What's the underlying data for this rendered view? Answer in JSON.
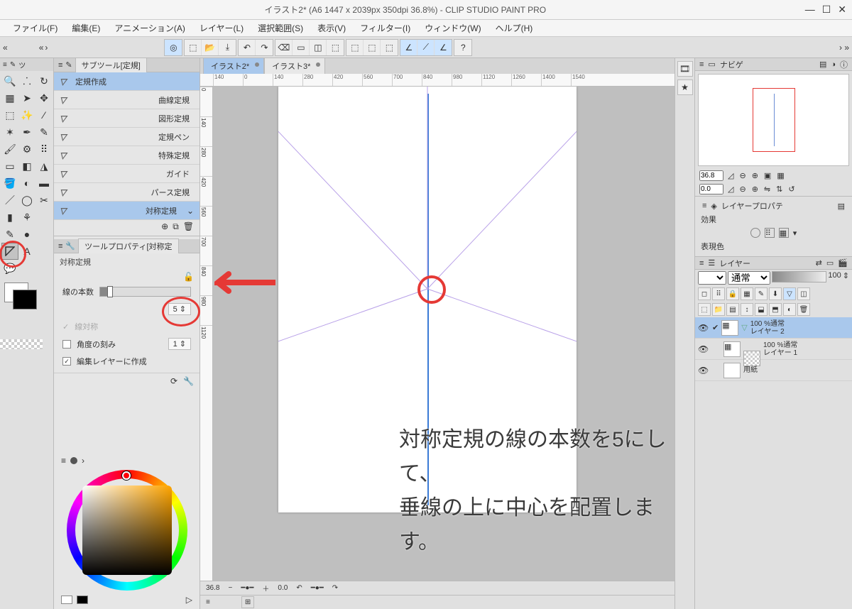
{
  "title": "イラスト2* (A6 1447 x 2039px 350dpi 36.8%)  -  CLIP STUDIO PAINT PRO",
  "menu": [
    "ファイル(F)",
    "編集(E)",
    "アニメーション(A)",
    "レイヤー(L)",
    "選択範囲(S)",
    "表示(V)",
    "フィルター(I)",
    "ウィンドウ(W)",
    "ヘルプ(H)"
  ],
  "docTabs": [
    {
      "label": "イラスト2*",
      "active": true
    },
    {
      "label": "イラスト3*",
      "active": false
    }
  ],
  "hRuler": [
    "140",
    "0",
    "140",
    "280",
    "420",
    "560",
    "700",
    "840",
    "980",
    "1120",
    "1260",
    "1400",
    "1540"
  ],
  "vRuler": [
    "0",
    "140",
    "280",
    "420",
    "560",
    "700",
    "840",
    "980",
    "1120"
  ],
  "subtool": {
    "title": "サブツール[定規]",
    "items": [
      {
        "label": "定規作成",
        "align": "left",
        "selected": true
      },
      {
        "label": "曲線定規",
        "selected": false
      },
      {
        "label": "図形定規",
        "selected": false
      },
      {
        "label": "定規ペン",
        "selected": false
      },
      {
        "label": "特殊定規",
        "selected": false
      },
      {
        "label": "ガイド",
        "selected": false
      },
      {
        "label": "パース定規",
        "selected": false
      },
      {
        "label": "対称定規",
        "selected": true
      }
    ]
  },
  "toolprop": {
    "title": "ツールプロパティ[対称定",
    "heading": "対称定規",
    "lines_label": "線の本数",
    "lines_value": "5",
    "linesym_label": "線対称",
    "angle_label": "角度の刻み",
    "angle_value": "1",
    "create_label": "編集レイヤーに作成"
  },
  "nav": {
    "title": "ナビゲ",
    "zoom": "36.8",
    "rot": "0.0"
  },
  "layerprop": {
    "title": "レイヤープロパテ",
    "effect": "効果",
    "expr": "表現色"
  },
  "layers": {
    "title": "レイヤー",
    "blend": "通常",
    "opacity": "100",
    "items": [
      {
        "name": "100 %通常",
        "sub": "レイヤー 2",
        "selected": true,
        "icon": "ruler"
      },
      {
        "name": "100 %通常",
        "sub": "レイヤー 1",
        "selected": false,
        "icon": "normal"
      },
      {
        "name": "用紙",
        "sub": "",
        "selected": false,
        "icon": "paper"
      }
    ]
  },
  "status": {
    "zoom": "36.8",
    "x": "0.0"
  },
  "caption": {
    "line1": "対称定規の線の本数を5にして、",
    "line2": "垂線の上に中心を配置します。"
  }
}
